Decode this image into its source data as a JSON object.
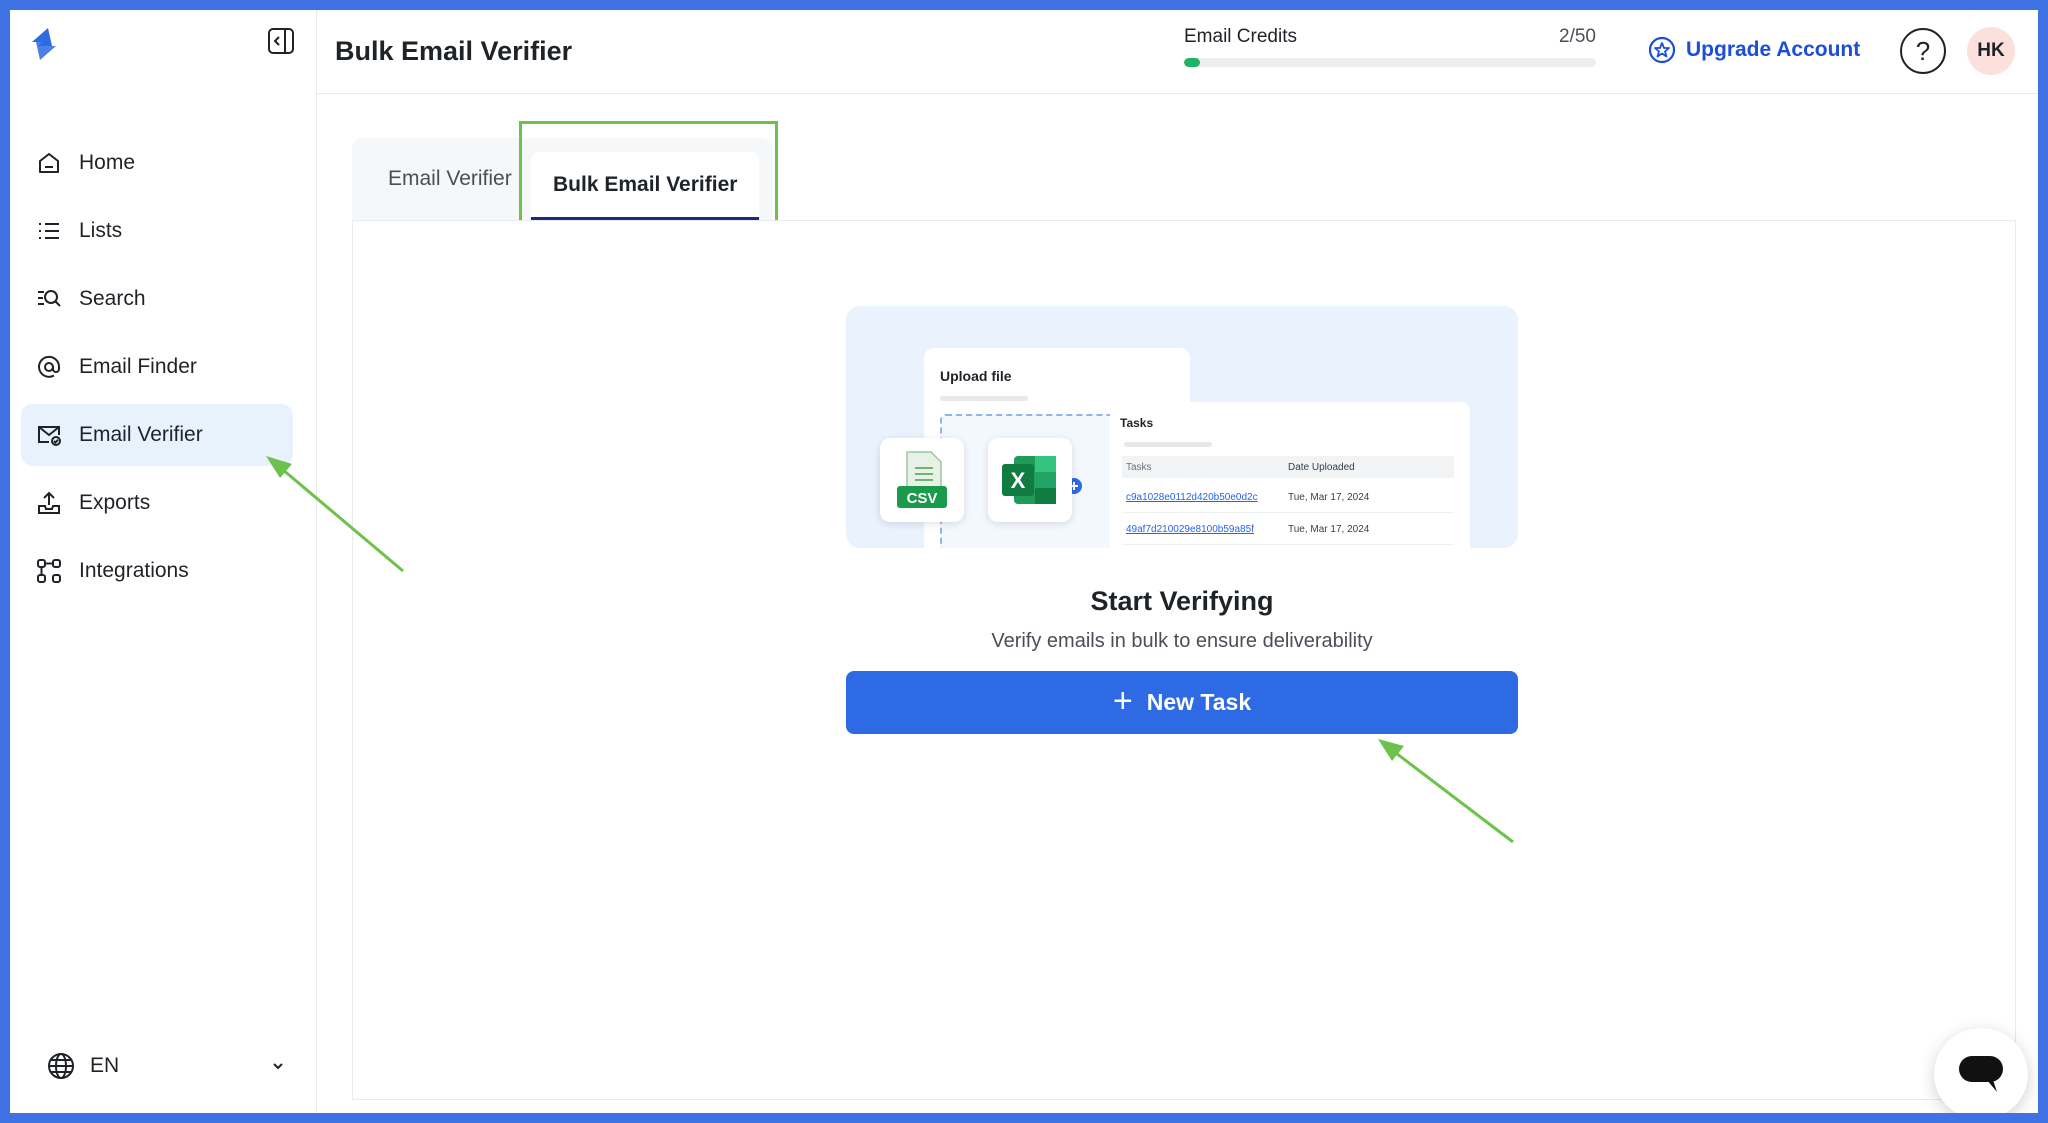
{
  "app": {
    "title": "Bulk Email Verifier"
  },
  "sidebar": {
    "items": [
      {
        "label": "Home",
        "icon": "home-icon",
        "active": false
      },
      {
        "label": "Lists",
        "icon": "list-icon",
        "active": false
      },
      {
        "label": "Search",
        "icon": "search-icon",
        "active": false
      },
      {
        "label": "Email Finder",
        "icon": "at-sign-icon",
        "active": false
      },
      {
        "label": "Email Verifier",
        "icon": "mail-check-icon",
        "active": true
      },
      {
        "label": "Exports",
        "icon": "upload-tray-icon",
        "active": false
      },
      {
        "label": "Integrations",
        "icon": "integrations-icon",
        "active": false
      }
    ],
    "language": "EN"
  },
  "header": {
    "credits_label": "Email Credits",
    "credits_value": "2/50",
    "credits_fraction": 0.04,
    "upgrade_label": "Upgrade Account",
    "help_label": "?",
    "avatar_initials": "HK"
  },
  "tabs": [
    {
      "label": "Email Verifier",
      "active": false
    },
    {
      "label": "Bulk Email Verifier",
      "active": true
    }
  ],
  "illustration": {
    "upload_title": "Upload file",
    "csv_label": "CSV",
    "excel_label": "X",
    "tasks_title": "Tasks",
    "columns": [
      "Tasks",
      "Date Uploaded"
    ],
    "rows": [
      {
        "task": "c9a1028e0112d420b50e0d2c",
        "date": "Tue, Mar 17, 2024"
      },
      {
        "task": "49af7d210029e8100b59a85f",
        "date": "Tue, Mar 17, 2024"
      }
    ]
  },
  "main": {
    "title": "Start Verifying",
    "subtitle": "Verify emails in bulk to ensure deliverability",
    "new_task_label": "New Task"
  },
  "colors": {
    "accent": "#2d6ae3",
    "annotation": "#6cc24a",
    "active_nav": "#e8f2fd",
    "credits_fill": "#1fb366"
  }
}
